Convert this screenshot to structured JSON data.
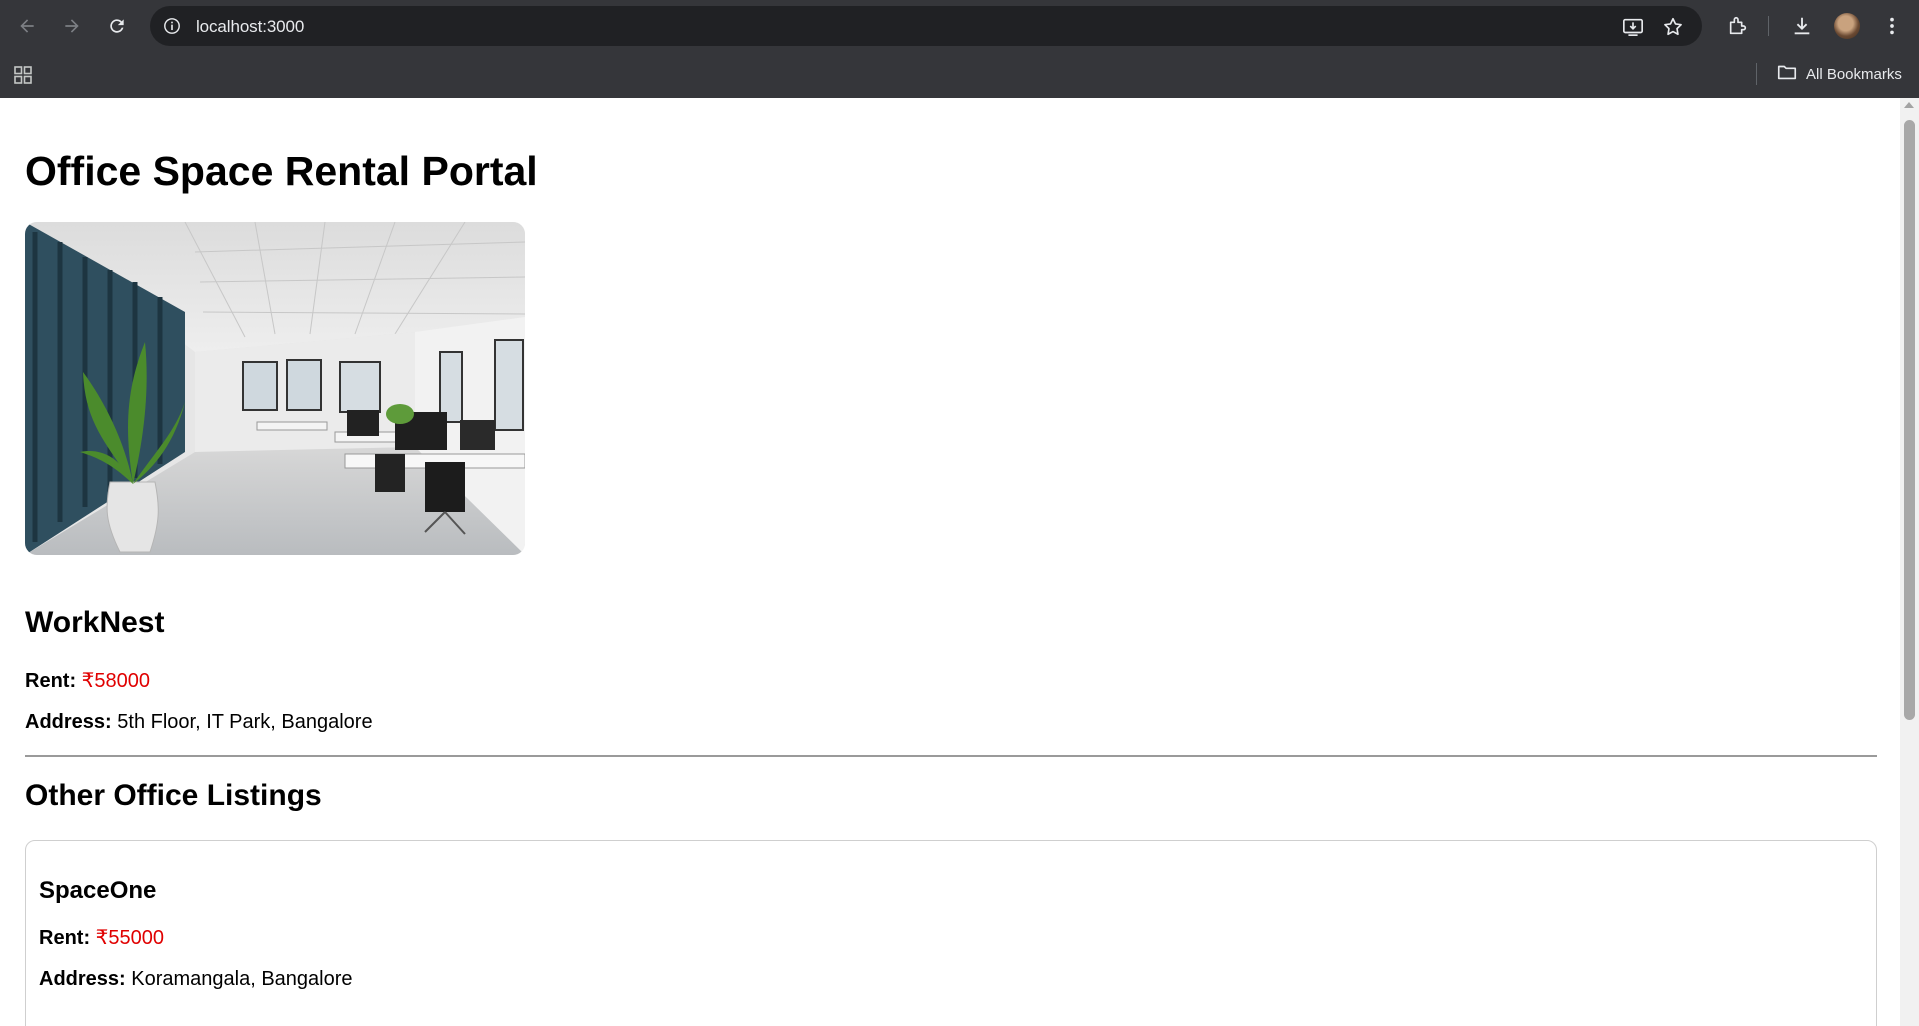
{
  "browser": {
    "url": "localhost:3000",
    "bookmarks_label": "All Bookmarks",
    "icons": [
      "back-icon",
      "forward-icon",
      "reload-icon",
      "site-info-icon",
      "install-icon",
      "star-icon",
      "extensions-icon",
      "download-icon",
      "avatar",
      "more-icon",
      "apps-icon",
      "folder-icon"
    ]
  },
  "page": {
    "title": "Office Space Rental Portal",
    "image_alt": "Office interior",
    "featured": {
      "name": "WorkNest",
      "rent_label": "Rent:",
      "rent_value": "₹58000",
      "address_label": "Address:",
      "address_value": "5th Floor, IT Park, Bangalore"
    },
    "other_heading": "Other Office Listings",
    "listings": [
      {
        "name": "SpaceOne",
        "rent_label": "Rent:",
        "rent_value": "₹55000",
        "address_label": "Address:",
        "address_value": "Koramangala, Bangalore"
      }
    ]
  },
  "colors": {
    "rent": "#e00000",
    "chrome_bg": "#35363a",
    "omnibox_bg": "#202124"
  }
}
